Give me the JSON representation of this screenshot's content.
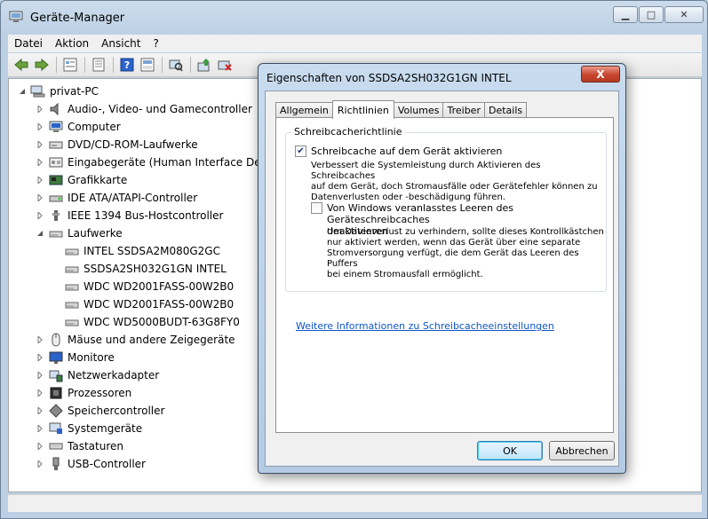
{
  "window": {
    "title": "Geräte-Manager"
  },
  "menu": [
    "Datei",
    "Aktion",
    "Ansicht",
    "?"
  ],
  "toolbar": {
    "buttons": [
      "back-icon",
      "forward-icon",
      "properties-view-icon",
      "console-icon",
      "help-icon",
      "show-hide-icon",
      "scan-hardware-icon",
      "update-driver-icon",
      "uninstall-icon"
    ]
  },
  "tree": {
    "root": "privat-PC",
    "nodes": [
      {
        "label": "Audio-, Video- und Gamecontroller",
        "icon": "speaker-icon",
        "expanded": false
      },
      {
        "label": "Computer",
        "icon": "computer-icon",
        "expanded": false
      },
      {
        "label": "DVD/CD-ROM-Laufwerke",
        "icon": "dvd-drive-icon",
        "expanded": false
      },
      {
        "label": "Eingabegeräte (Human Interface Devi",
        "icon": "hid-icon",
        "expanded": false
      },
      {
        "label": "Grafikkarte",
        "icon": "display-adapter-icon",
        "expanded": false
      },
      {
        "label": "IDE ATA/ATAPI-Controller",
        "icon": "ide-controller-icon",
        "expanded": false
      },
      {
        "label": "IEEE 1394 Bus-Hostcontroller",
        "icon": "firewire-icon",
        "expanded": false
      },
      {
        "label": "Laufwerke",
        "icon": "disk-drive-icon",
        "expanded": true,
        "children": [
          "INTEL SSDSA2M080G2GC",
          "SSDSA2SH032G1GN INTEL",
          "WDC WD2001FASS-00W2B0",
          "WDC WD2001FASS-00W2B0",
          "WDC WD5000BUDT-63G8FY0"
        ]
      },
      {
        "label": "Mäuse und andere Zeigegeräte",
        "icon": "mouse-icon",
        "expanded": false
      },
      {
        "label": "Monitore",
        "icon": "monitor-icon",
        "expanded": false
      },
      {
        "label": "Netzwerkadapter",
        "icon": "network-adapter-icon",
        "expanded": false
      },
      {
        "label": "Prozessoren",
        "icon": "processor-icon",
        "expanded": false
      },
      {
        "label": "Speichercontroller",
        "icon": "storage-controller-icon",
        "expanded": false
      },
      {
        "label": "Systemgeräte",
        "icon": "system-devices-icon",
        "expanded": false
      },
      {
        "label": "Tastaturen",
        "icon": "keyboard-icon",
        "expanded": false
      },
      {
        "label": "USB-Controller",
        "icon": "usb-icon",
        "expanded": false
      }
    ]
  },
  "dialog": {
    "title": "Eigenschaften von SSDSA2SH032G1GN INTEL",
    "close_label": "X",
    "tabs": [
      "Allgemein",
      "Richtlinien",
      "Volumes",
      "Treiber",
      "Details"
    ],
    "active_tab": "Richtlinien",
    "group_label": "Schreibcacherichtlinie",
    "option1": {
      "label": "Schreibcache auf dem Gerät aktivieren",
      "checked": true,
      "desc1": "Verbessert die Systemleistung durch Aktivieren des Schreibcaches",
      "desc2": "auf dem Gerät, doch Stromausfälle oder Gerätefehler können zu",
      "desc3": "Datenverlusten oder -beschädigung führen."
    },
    "option2": {
      "label1": "Von Windows veranlasstes Leeren des Geräteschreibcaches",
      "label2": "deaktivieren",
      "checked": false,
      "desc1": "Um Datenverlust zu verhindern, sollte dieses Kontrollkästchen",
      "desc2": "nur aktiviert werden, wenn das Gerät über eine separate",
      "desc3": "Stromversorgung verfügt, die dem Gerät das Leeren des Puffers",
      "desc4": "bei einem Stromausfall ermöglicht."
    },
    "link": "Weitere Informationen zu Schreibcacheeinstellungen",
    "ok_label": "OK",
    "cancel_label": "Abbrechen"
  },
  "colors": {
    "link": "#0f56c7",
    "titlebar": "#cddcec",
    "close_button": "#c7452f"
  }
}
